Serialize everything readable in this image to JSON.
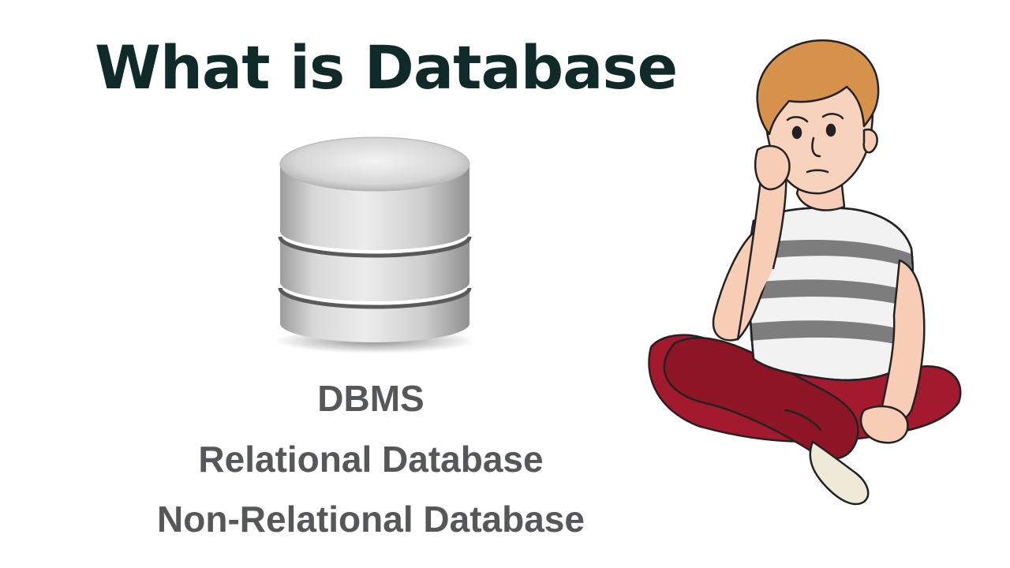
{
  "slide": {
    "title": "What is Database",
    "topics": [
      "DBMS",
      "Relational Database",
      "Non-Relational Database"
    ]
  },
  "illustrations": {
    "database": "database-cylinder-icon",
    "character": "thinking-boy-illustration"
  },
  "colors": {
    "background": "#ffffff",
    "title": "#0f2a28",
    "topics": "#555759",
    "shirt_stripe": "#7d7d7d",
    "pants": "#a3192e",
    "hair": "#d6924a"
  }
}
